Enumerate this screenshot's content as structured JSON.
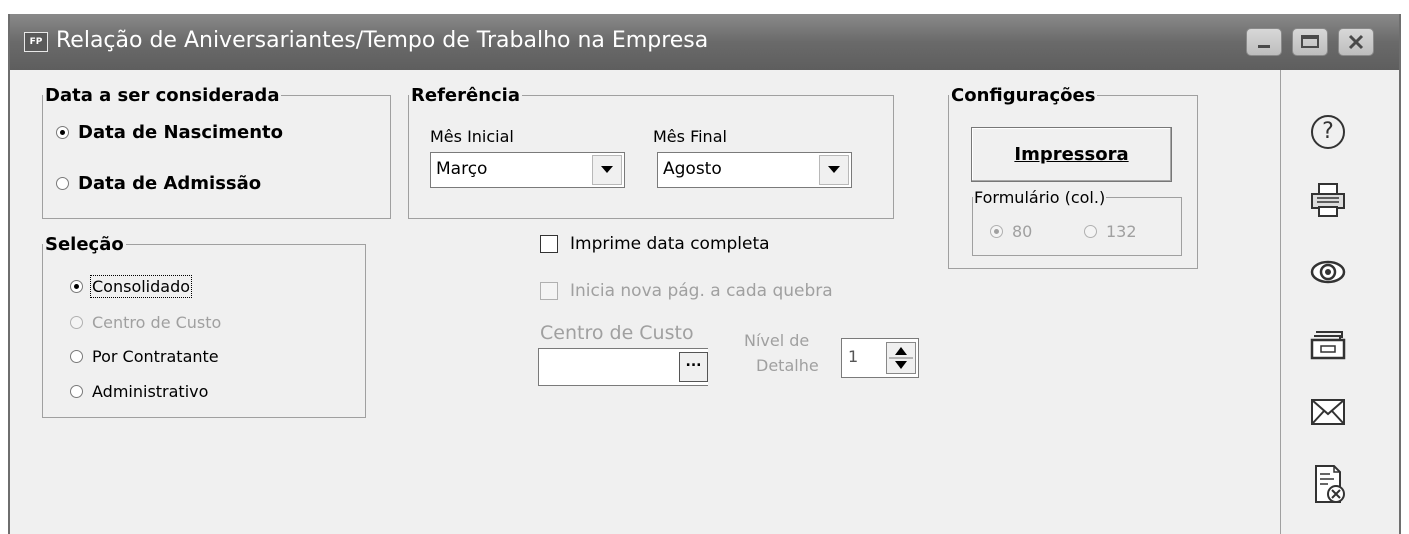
{
  "window": {
    "app_icon_text": "FP",
    "title": "Relação de Aniversariantes/Tempo de Trabalho na Empresa"
  },
  "data_group": {
    "legend": "Data a ser considerada",
    "options": [
      {
        "label": "Data de Nascimento",
        "selected": true
      },
      {
        "label": "Data de Admissão",
        "selected": false
      }
    ]
  },
  "referencia": {
    "legend": "Referência",
    "mes_inicial_label": "Mês Inicial",
    "mes_inicial_value": "Março",
    "mes_final_label": "Mês Final",
    "mes_final_value": "Agosto"
  },
  "config": {
    "legend": "Configurações",
    "impressora_label": "Impressora",
    "formulario_legend": "Formulário (col.)",
    "col80": "80",
    "col132": "132"
  },
  "selecao": {
    "legend": "Seleção",
    "options": [
      {
        "label": "Consolidado",
        "selected": true,
        "enabled": true
      },
      {
        "label": "Centro de Custo",
        "selected": false,
        "enabled": false
      },
      {
        "label": "Por Contratante",
        "selected": false,
        "enabled": true
      },
      {
        "label": "Administrativo",
        "selected": false,
        "enabled": true
      }
    ]
  },
  "options": {
    "imprime_data_completa": "Imprime data completa",
    "inicia_nova_pag": "Inicia nova pág. a cada quebra",
    "centro_custo_label": "Centro de Custo",
    "nivel_label_1": "Nível de",
    "nivel_label_2": "Detalhe",
    "nivel_value": "1",
    "ellipsis": "..."
  },
  "sidebar": {
    "help": "?",
    "icons": [
      "help-icon",
      "printer-icon",
      "preview-eye-icon",
      "export-icon",
      "email-icon",
      "close-report-icon"
    ]
  }
}
